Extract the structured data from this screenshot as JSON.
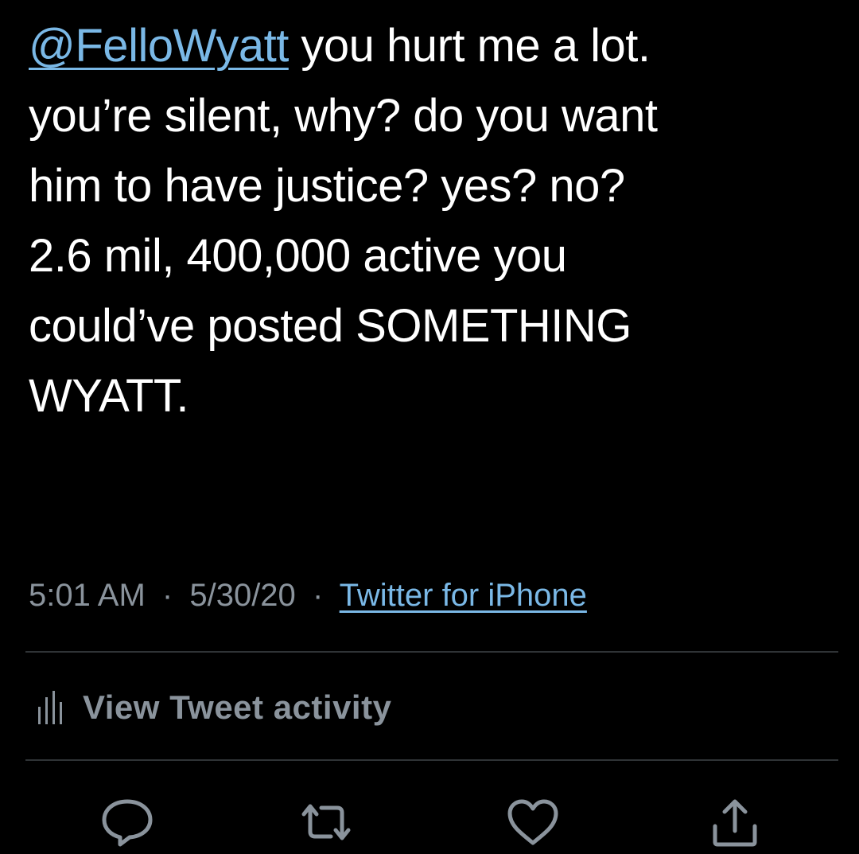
{
  "tweet": {
    "mention": "@FelloWyatt",
    "lines": [
      " you hurt me a lot.",
      "you’re silent, why? do you want",
      "him to have justice? yes? no?",
      "2.6 mil, 400,000 active you",
      "could’ve posted SOMETHING",
      "WYATT."
    ]
  },
  "meta": {
    "time": "5:01 AM",
    "separator": "·",
    "date": "5/30/20",
    "source": "Twitter for iPhone"
  },
  "activity": {
    "icon": "bar-chart-icon",
    "label": "View Tweet activity"
  },
  "actions": [
    {
      "name": "reply",
      "icon": "reply-icon"
    },
    {
      "name": "retweet",
      "icon": "retweet-icon"
    },
    {
      "name": "like",
      "icon": "heart-icon"
    },
    {
      "name": "share",
      "icon": "share-icon"
    }
  ],
  "colors": {
    "background": "#000000",
    "text": "#ffffff",
    "link": "#7ab8e6",
    "secondary": "#8a939c",
    "divider": "#2f3336"
  }
}
